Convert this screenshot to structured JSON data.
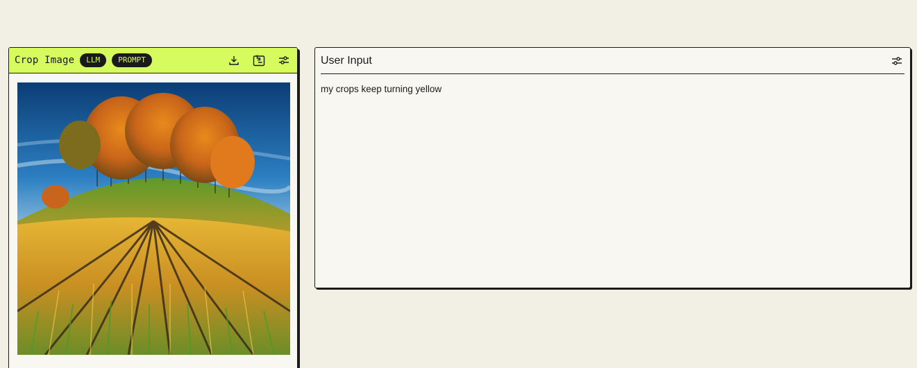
{
  "crop_card": {
    "title": "Crop Image",
    "badges": [
      "LLM",
      "PROMPT"
    ],
    "icons": [
      "download-icon",
      "copy-to-clipboard-icon",
      "settings-sliders-icon"
    ],
    "header_color": "#d5fb5e"
  },
  "input_card": {
    "title": "User Input",
    "value": "my crops keep turning yellow",
    "icons": [
      "settings-sliders-icon"
    ]
  },
  "colors": {
    "background": "#f2efe4",
    "card": "#f8f7f2",
    "accent": "#d5fb5e",
    "ink": "#1a1a1a"
  }
}
